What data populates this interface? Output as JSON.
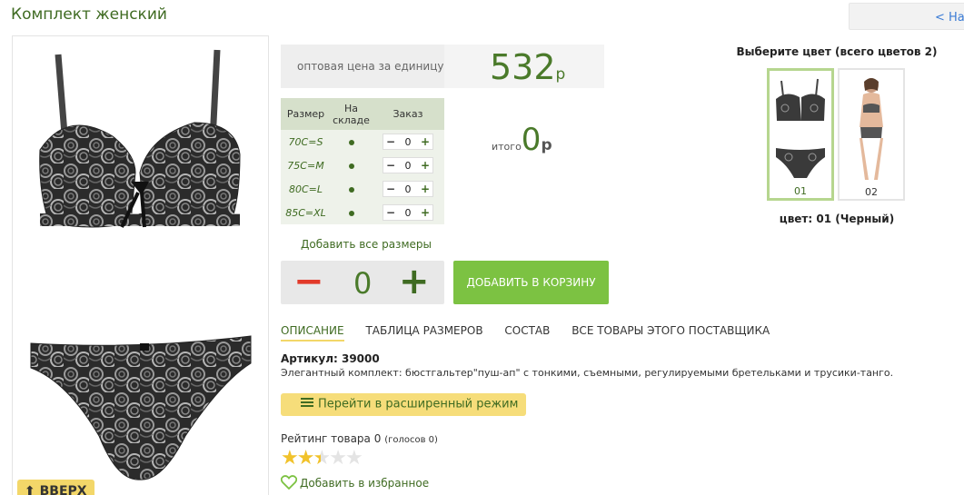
{
  "page": {
    "title": "Комплект женский",
    "back_link": "< Назад"
  },
  "photo": {
    "up_button": "⬆ ВВЕРХ"
  },
  "price": {
    "label": "оптовая цена за единицу",
    "value": "532",
    "currency": "р"
  },
  "sizes": {
    "headers": {
      "size": "Размер",
      "stock": "На складе",
      "order": "Заказ"
    },
    "rows": [
      {
        "size": "70C=S",
        "qty": "0"
      },
      {
        "size": "75C=M",
        "qty": "0"
      },
      {
        "size": "80C=L",
        "qty": "0"
      },
      {
        "size": "85C=XL",
        "qty": "0"
      }
    ],
    "add_all": "Добавить все размеры"
  },
  "total": {
    "label": "итого",
    "value": "0",
    "currency": "р"
  },
  "quantity": {
    "minus": "−",
    "value": "0",
    "plus": "+"
  },
  "cart_button": "ДОБАВИТЬ В КОРЗИНУ",
  "tabs": [
    "ОПИСАНИЕ",
    "ТАБЛИЦА РАЗМЕРОВ",
    "СОСТАВ",
    "ВСЕ ТОВАРЫ ЭТОГО ПОСТАВЩИКА"
  ],
  "article": "Артикул: 39000",
  "description": "Элегантный комплект: бюстгальтер\"пуш-ап\" с тонкими, съемными, регулируемыми бретельками и трусики-танго.",
  "advanced_mode": "Перейти в расширенный режим",
  "rating": {
    "label": "Рейтинг товара 0",
    "votes": "(голосов 0)",
    "stars_filled": 2.5,
    "stars_total": 5
  },
  "favorites": "Добавить в избранное",
  "colors": {
    "title": "Выберите цвет (всего цветов 2)",
    "items": [
      {
        "code": "01"
      },
      {
        "code": "02"
      }
    ],
    "current": "цвет: 01 (Черный)"
  },
  "icons": {
    "up": "arrow-up-icon",
    "advanced": "list-icon",
    "favorite": "heart-icon",
    "star": "star-icon"
  },
  "colors_theme": {
    "accent": "#7cc242",
    "brand_text": "#3f6b22",
    "highlight": "#f3d769",
    "minus_red": "#e23a2a"
  }
}
